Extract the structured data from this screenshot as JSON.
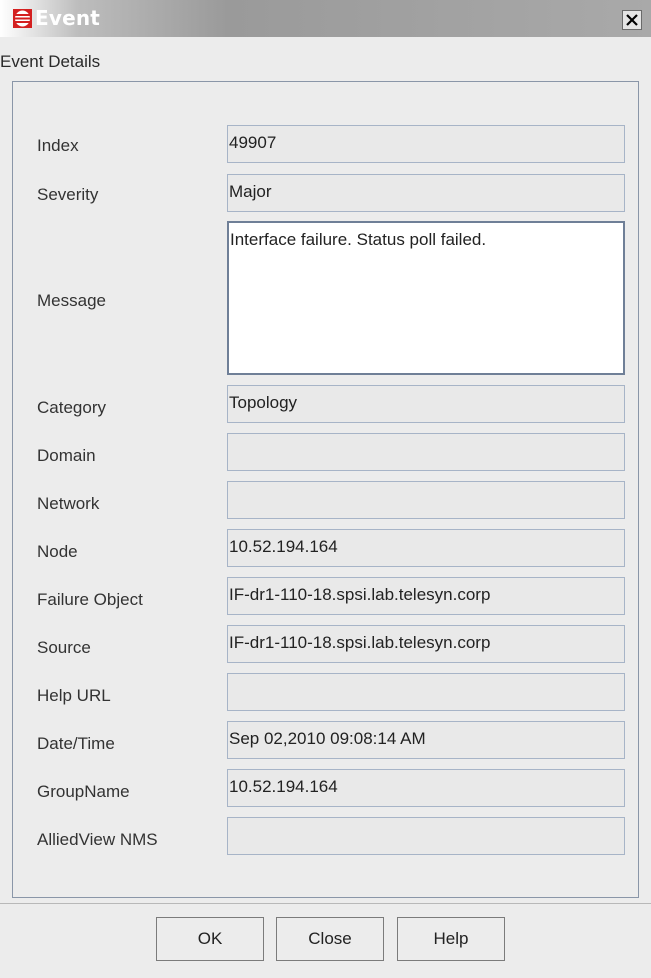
{
  "window": {
    "title": "Event",
    "close_label": "X"
  },
  "header": {
    "label": "Event Details"
  },
  "fields": {
    "index": {
      "label": "Index",
      "value": "49907"
    },
    "severity": {
      "label": "Severity",
      "value": "Major"
    },
    "message": {
      "label": "Message",
      "value": "Interface failure.  Status poll failed."
    },
    "category": {
      "label": "Category",
      "value": "Topology"
    },
    "domain": {
      "label": "Domain",
      "value": ""
    },
    "network": {
      "label": "Network",
      "value": ""
    },
    "node": {
      "label": "Node",
      "value": "10.52.194.164"
    },
    "failure_object": {
      "label": "Failure Object",
      "value": "IF-dr1-110-18.spsi.lab.telesyn.corp"
    },
    "source": {
      "label": "Source",
      "value": "IF-dr1-110-18.spsi.lab.telesyn.corp"
    },
    "help_url": {
      "label": "Help URL",
      "value": ""
    },
    "date_time": {
      "label": "Date/Time",
      "value": "Sep 02,2010 09:08:14 AM"
    },
    "group_name": {
      "label": "GroupName",
      "value": "10.52.194.164"
    },
    "alliedview_nms": {
      "label": "AlliedView NMS",
      "value": ""
    }
  },
  "buttons": {
    "ok": "OK",
    "close": "Close",
    "help": "Help"
  },
  "colors": {
    "title_icon": "#d42020",
    "panel_border": "#8a96a8"
  }
}
